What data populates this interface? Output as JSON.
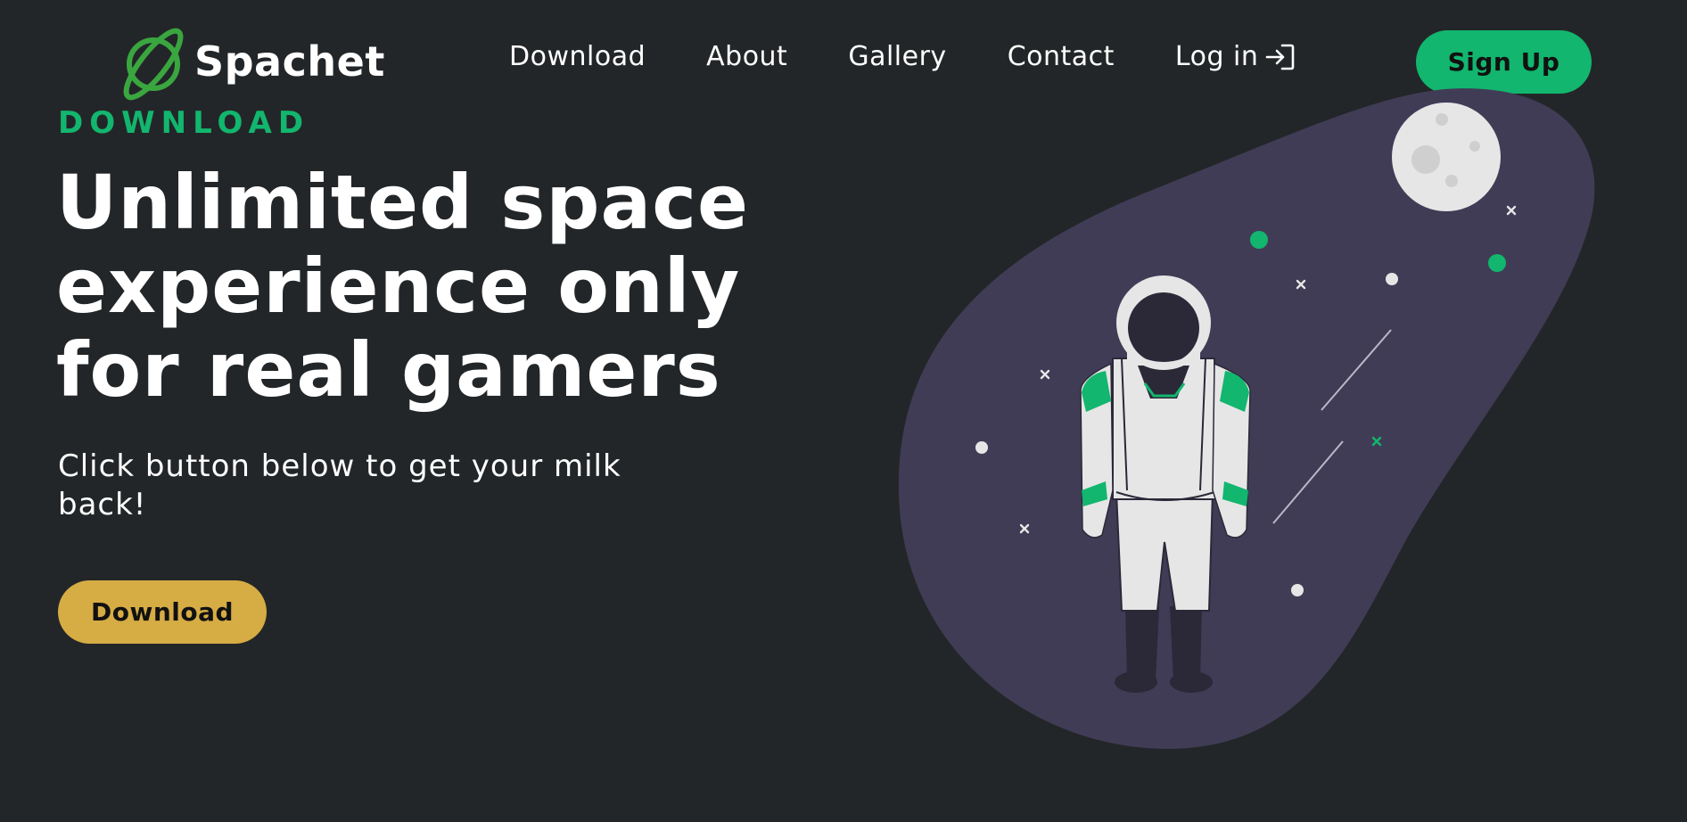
{
  "brand": {
    "name": "Spachet",
    "logo_icon": "planet-icon",
    "accent_color": "#12b66e"
  },
  "nav": {
    "items": [
      {
        "label": "Download"
      },
      {
        "label": "About"
      },
      {
        "label": "Gallery"
      },
      {
        "label": "Contact"
      },
      {
        "label": "Log in",
        "icon": "login-arrow-icon"
      }
    ],
    "signup_label": "Sign Up"
  },
  "hero": {
    "eyebrow": "DOWNLOAD",
    "headline": "Unlimited space experience only for real gamers",
    "subtext": "Click button below to get your milk back!",
    "cta_label": "Download",
    "cta_color": "#d6ac44"
  },
  "colors": {
    "background": "#232628",
    "blob": "#403c56",
    "signup_button": "#12b66e",
    "download_button": "#d6ac44"
  },
  "illustration": {
    "name": "astronaut-illustration"
  }
}
